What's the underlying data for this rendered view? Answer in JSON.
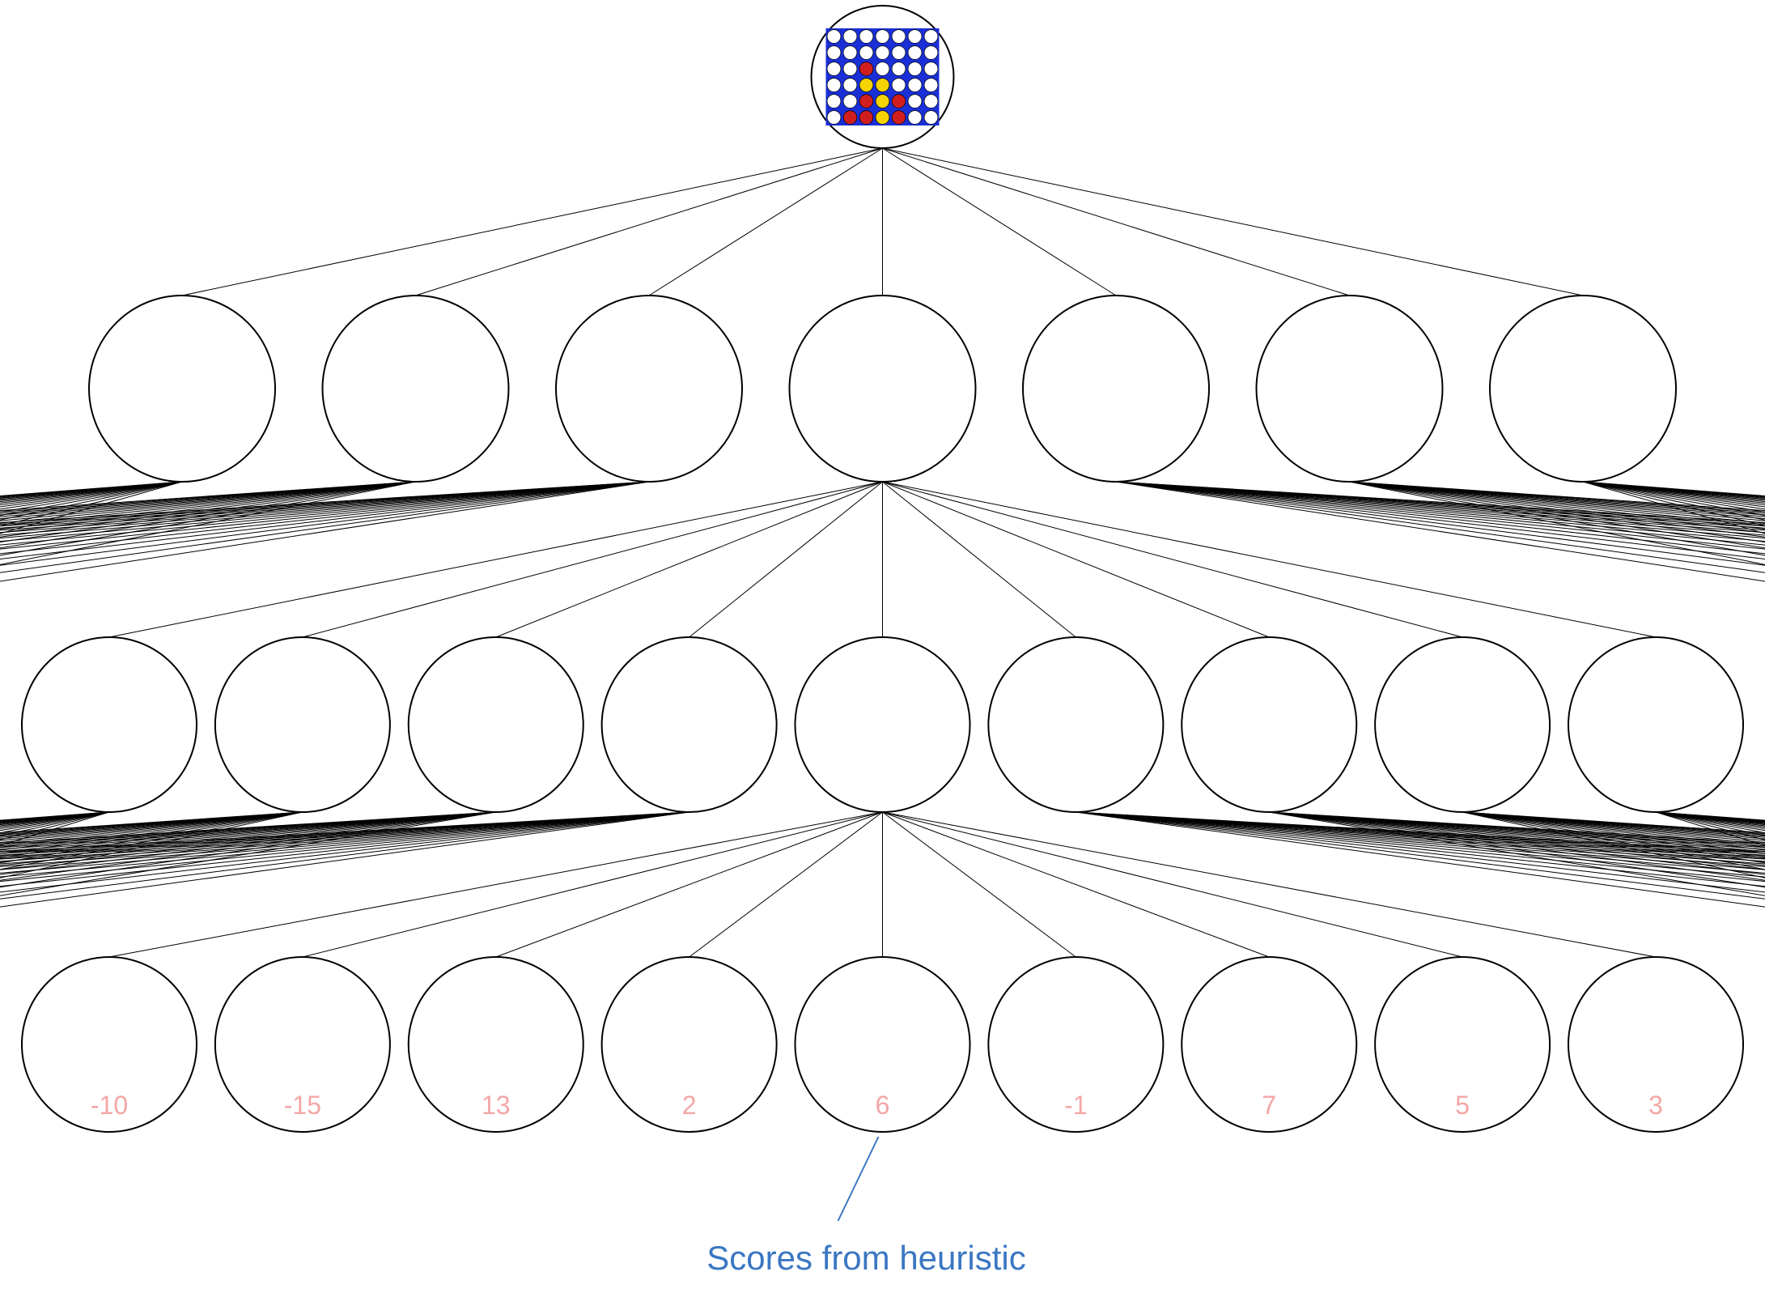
{
  "chart_data": {
    "type": "tree",
    "description": "Game tree for Connect-Four minimax search. Root is the current board state; 7 children at ply 1 (one per column). Each ply-1 node fans out to many ply-2 nodes (mostly off-canvas). Center ply-2 node fans to 9 ply-3 leaves whose heuristic scores are shown.",
    "root": {
      "game": "connect-four",
      "board_cols": 7,
      "board_rows": 6,
      "board_colors": {
        "bg": "#1a2fd6",
        "empty": "#ffffff",
        "p1": "#d01e1e",
        "p2": "#f4d300"
      },
      "board": [
        [
          "E",
          "E",
          "E",
          "E",
          "E",
          "E",
          "E"
        ],
        [
          "E",
          "E",
          "E",
          "E",
          "E",
          "E",
          "E"
        ],
        [
          "E",
          "E",
          "R",
          "E",
          "E",
          "E",
          "E"
        ],
        [
          "E",
          "E",
          "Y",
          "Y",
          "E",
          "E",
          "E"
        ],
        [
          "E",
          "E",
          "R",
          "Y",
          "R",
          "E",
          "E"
        ],
        [
          "E",
          "R",
          "R",
          "Y",
          "R",
          "E",
          "E"
        ]
      ]
    },
    "ply1_children": 7,
    "ply2_visible_children": 9,
    "ply3_leaves": 9,
    "leaf_scores": [
      -10,
      -15,
      13,
      2,
      6,
      -1,
      7,
      5,
      3
    ],
    "caption": "Scores from heuristic"
  }
}
